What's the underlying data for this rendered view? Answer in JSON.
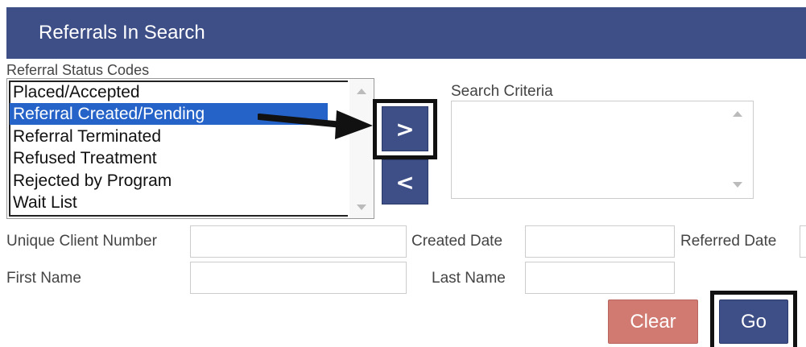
{
  "header": {
    "title": "Referrals In Search"
  },
  "status_codes": {
    "label": "Referral Status Codes",
    "items": [
      {
        "label": "Placed/Accepted",
        "selected": false
      },
      {
        "label": "Referral Created/Pending",
        "selected": true
      },
      {
        "label": "Referral Terminated",
        "selected": false
      },
      {
        "label": "Refused Treatment",
        "selected": false
      },
      {
        "label": "Rejected by Program",
        "selected": false
      },
      {
        "label": "Wait List",
        "selected": false
      }
    ]
  },
  "transfer": {
    "add_label": ">",
    "remove_label": "<"
  },
  "search_criteria": {
    "label": "Search Criteria",
    "items": []
  },
  "fields": {
    "unique_client_number": {
      "label": "Unique Client Number",
      "value": ""
    },
    "created_date": {
      "label": "Created Date",
      "value": ""
    },
    "referred_date": {
      "label": "Referred Date",
      "value": ""
    },
    "first_name": {
      "label": "First Name",
      "value": ""
    },
    "last_name": {
      "label": "Last Name",
      "value": ""
    }
  },
  "actions": {
    "clear_label": "Clear",
    "go_label": "Go"
  },
  "colors": {
    "header": "#3e4e87",
    "selected": "#2563c9",
    "clear": "#d07a72",
    "go": "#3e4e87"
  }
}
